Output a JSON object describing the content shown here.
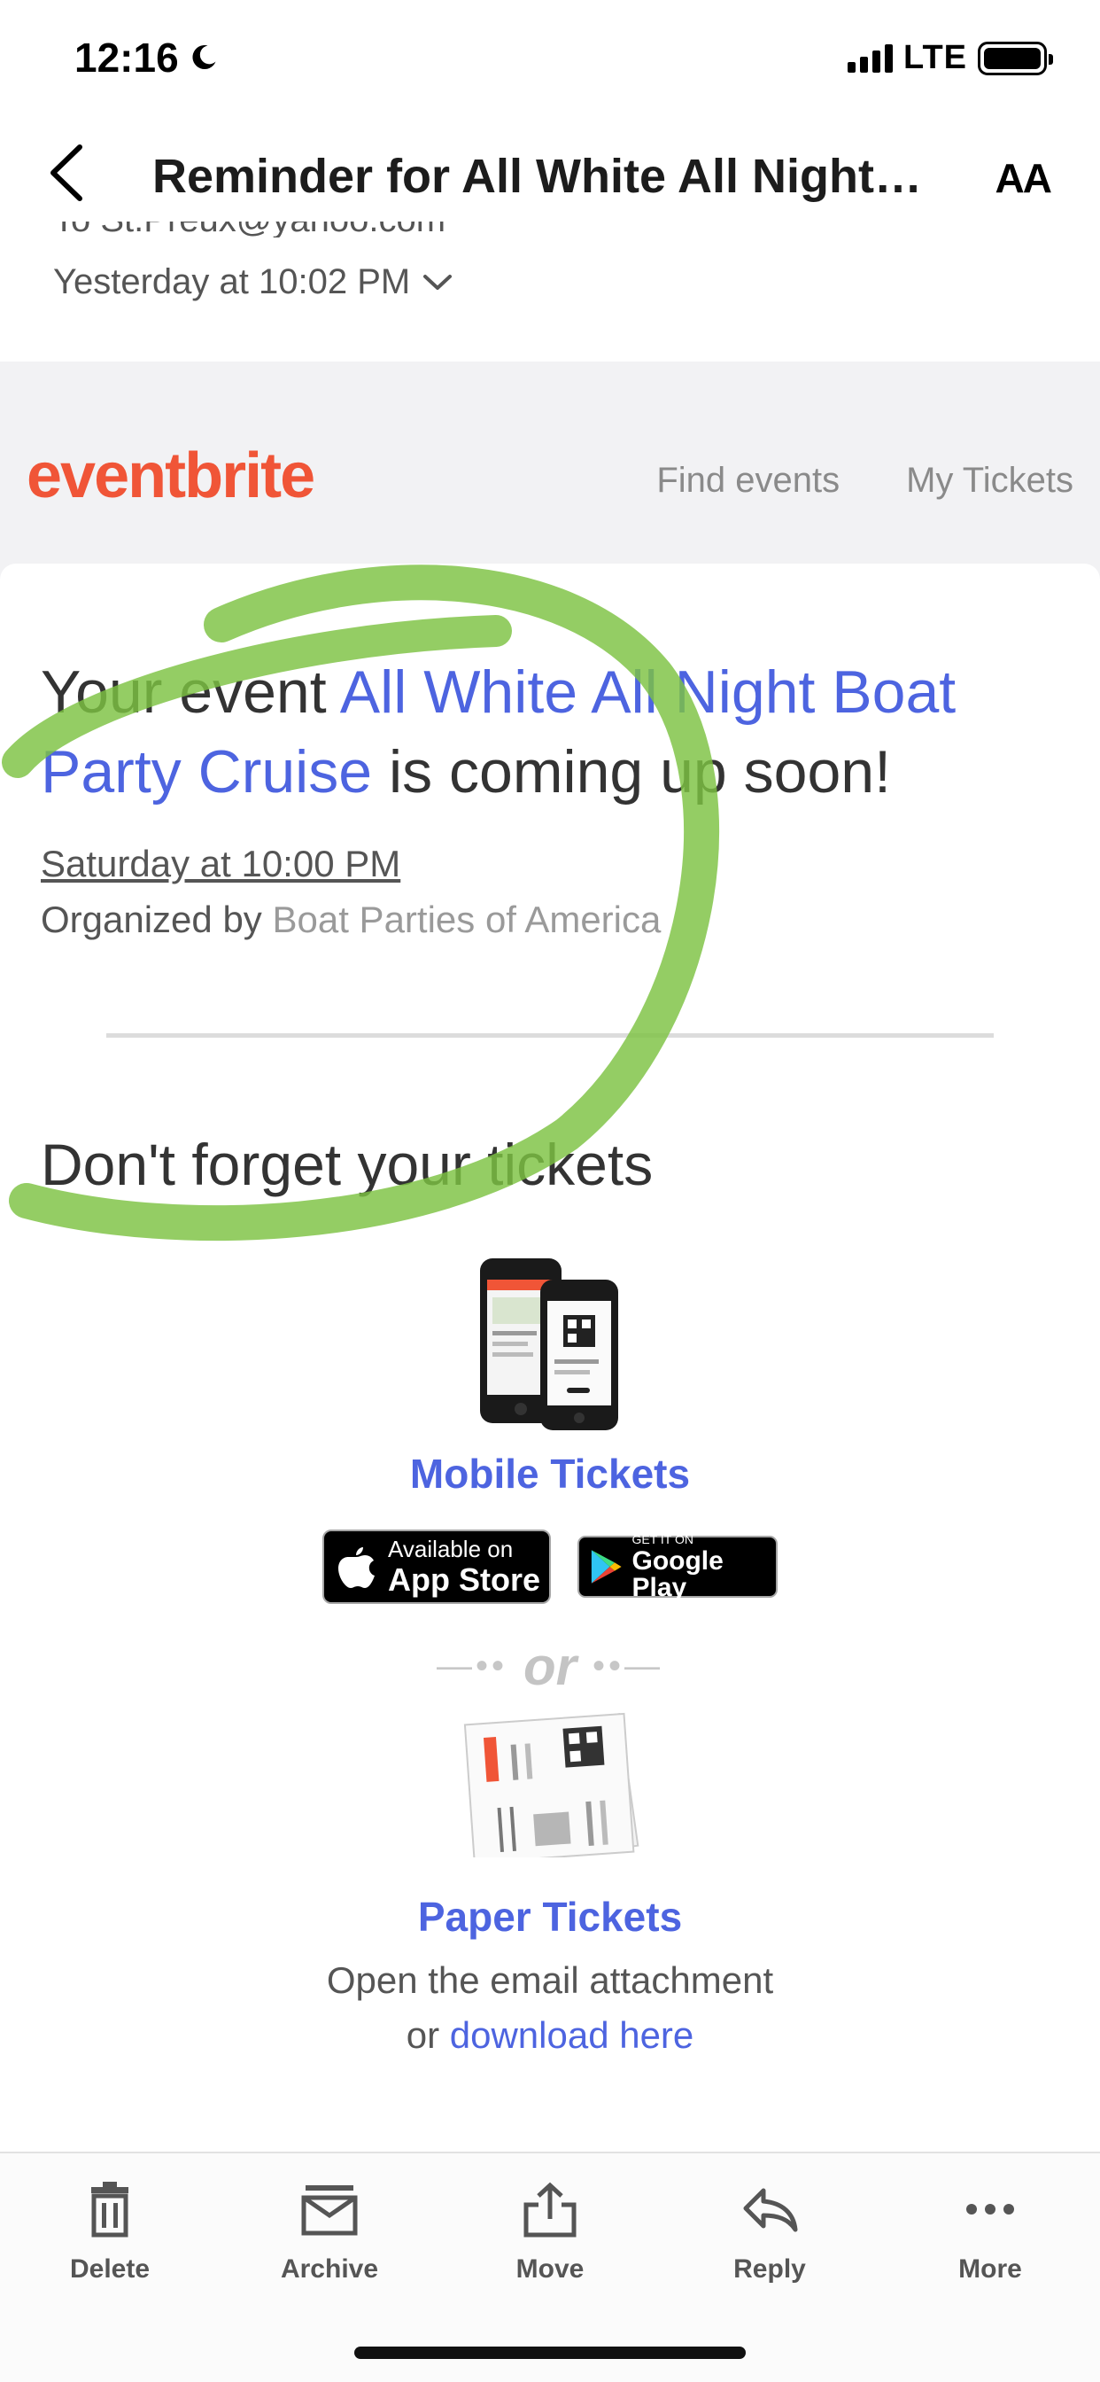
{
  "status_bar": {
    "time": "12:16",
    "network": "LTE"
  },
  "nav": {
    "title": "Reminder for All White All Night -...",
    "text_size_label": "AA"
  },
  "meta": {
    "to_line": "To St.Preux@yahoo.com",
    "date": "Yesterday at 10:02 PM"
  },
  "email": {
    "logo": "eventbrite",
    "nav_links": [
      "Find events",
      "My Tickets"
    ],
    "headline_prefix": "Your event ",
    "event_name": "All White All Night Boat Party Cruise",
    "headline_suffix": " is coming up soon!",
    "event_date": "Saturday at 10:00 PM",
    "organized_by_label": "Organized by ",
    "organizer_name": "Boat Parties of America",
    "tickets_heading": "Don't forget your tickets",
    "mobile_tickets_label": "Mobile Tickets",
    "app_store_small": "Available on",
    "app_store_large": "App Store",
    "google_play_small": "GET IT ON",
    "google_play_large": "Google Play",
    "or_label": "or",
    "paper_tickets_label": "Paper Tickets",
    "paper_line1": "Open the email attachment",
    "paper_line2_prefix": "or ",
    "download_link": "download here"
  },
  "toolbar": {
    "items": [
      {
        "label": "Delete",
        "icon": "trash-icon"
      },
      {
        "label": "Archive",
        "icon": "archive-icon"
      },
      {
        "label": "Move",
        "icon": "move-icon"
      },
      {
        "label": "Reply",
        "icon": "reply-icon"
      },
      {
        "label": "More",
        "icon": "more-icon"
      }
    ]
  },
  "colors": {
    "brand_orange": "#f05537",
    "link_blue": "#4d64e0",
    "highlighter_green": "#7dc242"
  }
}
